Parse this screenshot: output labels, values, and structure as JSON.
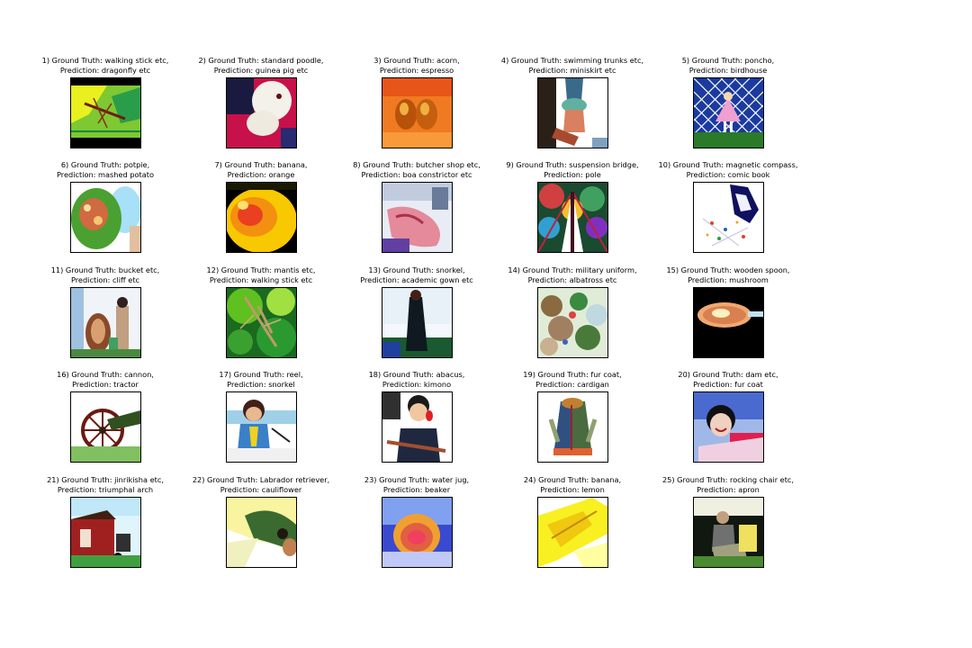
{
  "panels": [
    {
      "ground_truth": "1) Ground Truth: walking stick etc,",
      "prediction": "Prediction: dragonfly etc",
      "subject": "green insect on leaves"
    },
    {
      "ground_truth": "2) Ground Truth: standard poodle,",
      "prediction": "Prediction: guinea pig etc",
      "subject": "white dog on magenta background"
    },
    {
      "ground_truth": "3) Ground Truth: acorn,",
      "prediction": "Prediction: espresso",
      "subject": "two acorns on orange surface"
    },
    {
      "ground_truth": "4) Ground Truth: swimming trunks etc,",
      "prediction": "Prediction: miniskirt etc",
      "subject": "person legs on white background"
    },
    {
      "ground_truth": "5) Ground Truth: poncho,",
      "prediction": "Prediction: birdhouse",
      "subject": "child in poncho before lattice fence"
    },
    {
      "ground_truth": "6) Ground Truth: potpie,",
      "prediction": "Prediction: mashed potato",
      "subject": "food in bowl"
    },
    {
      "ground_truth": "7) Ground Truth: banana,",
      "prediction": "Prediction: orange",
      "subject": "yellow fruit close-up"
    },
    {
      "ground_truth": "8) Ground Truth: butcher shop etc,",
      "prediction": "Prediction: boa constrictor etc",
      "subject": "raw meat display"
    },
    {
      "ground_truth": "9) Ground Truth: suspension bridge,",
      "prediction": "Prediction: pole",
      "subject": "bridge in colorful foliage"
    },
    {
      "ground_truth": "10) Ground Truth: magnetic compass,",
      "prediction": "Prediction: comic book",
      "subject": "compass on map"
    },
    {
      "ground_truth": "11) Ground Truth: bucket etc,",
      "prediction": "Prediction: cliff etc",
      "subject": "people with buckets outdoors"
    },
    {
      "ground_truth": "12) Ground Truth: mantis etc,",
      "prediction": "Prediction: walking stick etc",
      "subject": "mantis on green leaves"
    },
    {
      "ground_truth": "13) Ground Truth: snorkel,",
      "prediction": "Prediction: academic gown etc",
      "subject": "dark figure standing"
    },
    {
      "ground_truth": "14) Ground Truth: military uniform,",
      "prediction": "Prediction: albatross etc",
      "subject": "crowded outdoor scene"
    },
    {
      "ground_truth": "15) Ground Truth: wooden spoon,",
      "prediction": "Prediction: mushroom",
      "subject": "spoon on black background"
    },
    {
      "ground_truth": "16) Ground Truth: cannon,",
      "prediction": "Prediction: tractor",
      "subject": "cannon with spoked wheel"
    },
    {
      "ground_truth": "17) Ground Truth: reel,",
      "prediction": "Prediction: snorkel",
      "subject": "child fishing"
    },
    {
      "ground_truth": "18) Ground Truth: abacus,",
      "prediction": "Prediction: kimono",
      "subject": "child with abacus"
    },
    {
      "ground_truth": "19) Ground Truth: fur coat,",
      "prediction": "Prediction: cardigan",
      "subject": "coat on white background"
    },
    {
      "ground_truth": "20) Ground Truth: dam etc,",
      "prediction": "Prediction: fur coat",
      "subject": "smiling woman outdoors"
    },
    {
      "ground_truth": "21) Ground Truth: jinrikisha etc,",
      "prediction": "Prediction: triumphal arch",
      "subject": "red building and rickshaw"
    },
    {
      "ground_truth": "22) Ground Truth: Labrador retriever,",
      "prediction": "Prediction: cauliflower",
      "subject": "dog on bright background"
    },
    {
      "ground_truth": "23) Ground Truth: water jug,",
      "prediction": "Prediction: beaker",
      "subject": "jug with blue heatmap"
    },
    {
      "ground_truth": "24) Ground Truth: banana,",
      "prediction": "Prediction: lemon",
      "subject": "yellow bananas"
    },
    {
      "ground_truth": "25) Ground Truth: rocking chair etc,",
      "prediction": "Prediction: apron",
      "subject": "person sitting in dark room"
    }
  ]
}
